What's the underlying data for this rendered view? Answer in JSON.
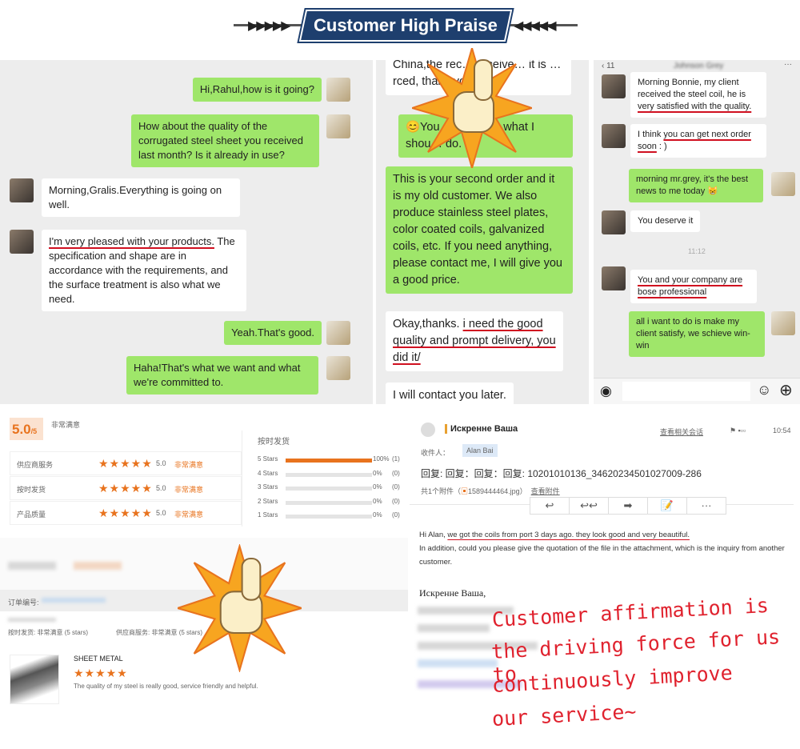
{
  "banner": {
    "title": "Customer High Praise",
    "left_arrows": "▶▶▶▶▶",
    "right_arrows": "◀◀◀◀◀"
  },
  "chat1": {
    "messages": [
      {
        "from": "me",
        "text": "Hi,Rahul,how is it going?"
      },
      {
        "from": "me",
        "text": "How about the quality of the corrugated steel sheet you received last month? Is it already in use?"
      },
      {
        "from": "them",
        "text": "Morning,Gralis.Everything is going on well."
      },
      {
        "from": "them",
        "highlight": "I'm very pleased with your products.",
        "text": " The specification and shape are in accordance with the requirements, and the surface treatment is also what we need."
      },
      {
        "from": "me",
        "text": "Yeah.That's good."
      },
      {
        "from": "me",
        "text": "Haha!That's what we want and what we're committed to."
      }
    ]
  },
  "chat2": {
    "messages": [
      {
        "from": "them",
        "text": "China,the rec… receive… it is … rced, thank you."
      },
      {
        "from": "me",
        "text": "😊You … ar,this is what I shou… do."
      },
      {
        "from": "me",
        "text": "This is your second order and it is my old customer. We also produce stainless steel plates, color coated coils, galvanized coils, etc. If you need anything, please contact me, I will give you a good  price."
      },
      {
        "from": "them",
        "prefix": "Okay,thanks. ",
        "highlight": "i need the good quality and prompt delivery, you did it/"
      },
      {
        "from": "them",
        "text": "I will contact you later."
      }
    ]
  },
  "chat3": {
    "back_count": "11",
    "contact": "Johnson Grey",
    "menu": "···",
    "messages": [
      {
        "from": "them",
        "text": "Morning Bonnie, my client received the steel coil, he is ",
        "highlight": "very satisfied with the quality."
      },
      {
        "from": "them",
        "prefix": "I think ",
        "highlight": "you can get next order soon",
        "suffix": " : )"
      },
      {
        "from": "me",
        "text": "morning mr.grey, it's the best news to me today 😸"
      },
      {
        "from": "them",
        "text": "You deserve it"
      },
      {
        "from": "them",
        "highlight": "You and your company are bose professional"
      },
      {
        "from": "me",
        "text": "all i want to do is make my client satisfy, we schieve win-win"
      }
    ],
    "time": "11:12"
  },
  "rating": {
    "score": "5.0",
    "out_of": "/5",
    "summary": "非常满意",
    "rows": [
      {
        "label": "供应商服务",
        "score": "5.0",
        "text": "非常满意"
      },
      {
        "label": "按时发货",
        "score": "5.0",
        "text": "非常满意"
      },
      {
        "label": "产品质量",
        "score": "5.0",
        "text": "非常满意"
      }
    ],
    "dist_title": "按时发货",
    "dist": [
      {
        "label": "5 Stars",
        "pct": 100,
        "pct_text": "100%",
        "count": "(1)"
      },
      {
        "label": "4 Stars",
        "pct": 0,
        "pct_text": "0%",
        "count": "(0)"
      },
      {
        "label": "3 Stars",
        "pct": 0,
        "pct_text": "0%",
        "count": "(0)"
      },
      {
        "label": "2 Stars",
        "pct": 0,
        "pct_text": "0%",
        "count": "(0)"
      },
      {
        "label": "1 Stars",
        "pct": 0,
        "pct_text": "0%",
        "count": "(0)"
      }
    ],
    "order_label": "订单编号:",
    "line1": "按时发货: 非常满意",
    "line1b": "(5 stars)",
    "line2": "供应商服务: 非常满意",
    "line2b": "(5 stars)",
    "product": "SHEET METAL",
    "stars": "★★★★★",
    "review": "The quality of my steel is really good, service friendly and helpful."
  },
  "email": {
    "sender": "Искренне Ваша",
    "related": "查看相关会话",
    "time": "10:54",
    "to_label": "收件人：",
    "to": "Alan Bai",
    "subject": "回复: 回复：回复：回复: 10201010136_34620234501027009-286",
    "attach_prefix": "共1个附件（",
    "attach_file": "1589444464.jpg",
    "attach_suffix": "）",
    "view_attach": "查看附件",
    "toolbar": [
      "↩",
      "↩↩",
      "➡",
      "📝",
      "···"
    ],
    "greeting": "Hi Alan, ",
    "highlight": "we got the coils from port 3 days ago. they look good and very beautiful.",
    "body": "In addition, could you please give the quotation of the file in the attachment, which is the inquiry from another customer.",
    "signoff": "Искренне Ваша,"
  },
  "slogan": [
    "Customer affirmation is",
    "the driving force for us to",
    "continuously improve",
    "our service~"
  ]
}
